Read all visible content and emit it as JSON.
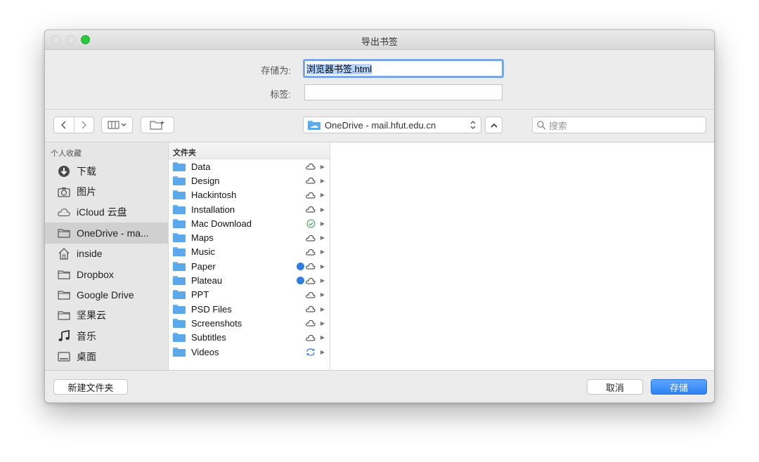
{
  "window": {
    "title": "导出书签"
  },
  "form": {
    "save_as_label": "存储为:",
    "save_as_value": "浏览器书签.html",
    "tags_label": "标签:",
    "tags_value": ""
  },
  "toolbar": {
    "location": "OneDrive - mail.hfut.edu.cn",
    "search_placeholder": "搜索"
  },
  "sidebar": {
    "header": "个人收藏",
    "items": [
      {
        "label": "下载",
        "icon": "download-icon"
      },
      {
        "label": "图片",
        "icon": "camera-icon"
      },
      {
        "label": "iCloud 云盘",
        "icon": "cloud-icon"
      },
      {
        "label": "OneDrive - ma...",
        "icon": "folder-icon",
        "selected": true
      },
      {
        "label": "inside",
        "icon": "home-icon"
      },
      {
        "label": "Dropbox",
        "icon": "folder-icon"
      },
      {
        "label": "Google Drive",
        "icon": "folder-icon"
      },
      {
        "label": "坚果云",
        "icon": "folder-icon"
      },
      {
        "label": "音乐",
        "icon": "music-icon"
      },
      {
        "label": "桌面",
        "icon": "desktop-icon"
      }
    ]
  },
  "column": {
    "header": "文件夹",
    "rows": [
      {
        "name": "Data",
        "status": "cloud"
      },
      {
        "name": "Design",
        "status": "cloud"
      },
      {
        "name": "Hackintosh",
        "status": "cloud"
      },
      {
        "name": "Installation",
        "status": "cloud"
      },
      {
        "name": "Mac Download",
        "status": "synced"
      },
      {
        "name": "Maps",
        "status": "cloud"
      },
      {
        "name": "Music",
        "status": "cloud"
      },
      {
        "name": "Paper",
        "status": "cloud",
        "tag": "blue"
      },
      {
        "name": "Plateau",
        "status": "cloud",
        "tag": "blue"
      },
      {
        "name": "PPT",
        "status": "cloud"
      },
      {
        "name": "PSD Files",
        "status": "cloud"
      },
      {
        "name": "Screenshots",
        "status": "cloud"
      },
      {
        "name": "Subtitles",
        "status": "cloud"
      },
      {
        "name": "Videos",
        "status": "syncing"
      }
    ]
  },
  "buttons": {
    "new_folder": "新建文件夹",
    "cancel": "取消",
    "save": "存储"
  },
  "colors": {
    "accent": "#2f82f5",
    "tag_blue": "#2f7de1",
    "synced_green": "#2aa14a"
  }
}
